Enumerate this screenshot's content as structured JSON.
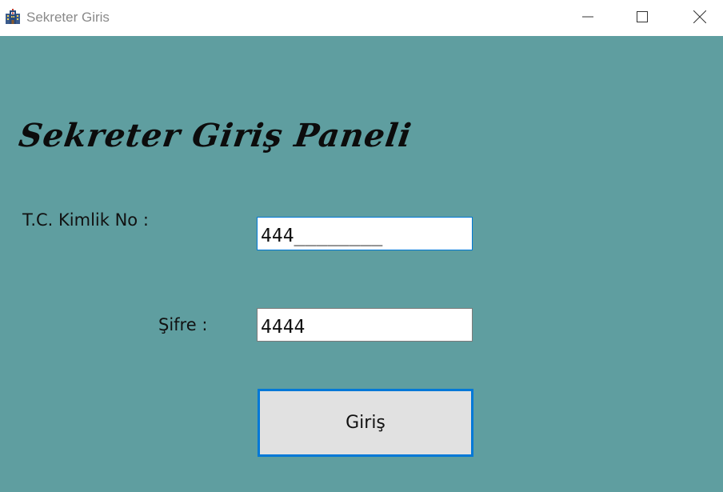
{
  "window": {
    "title": "Sekreter Giris",
    "icon": "hospital-building-icon",
    "background_color": "#5f9ea0",
    "controls": {
      "minimize_icon": "minimize-icon",
      "maximize_icon": "maximize-icon",
      "close_icon": "close-icon"
    }
  },
  "panel": {
    "title": "Sekreter Giriş Paneli"
  },
  "form": {
    "tc_label": "T.C. Kimlik No :",
    "tc_value": "444________",
    "password_label": "Şifre :",
    "password_value": "4444",
    "submit_label": "Giriş",
    "accent_color": "#0078d7",
    "button_color": "#e1e1e1"
  }
}
